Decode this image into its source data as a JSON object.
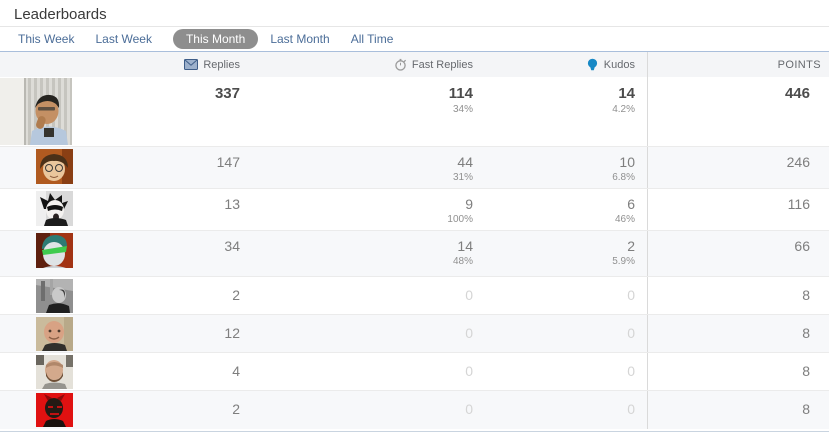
{
  "page": {
    "title": "Leaderboards"
  },
  "tabs": [
    {
      "label": "This Week",
      "active": false
    },
    {
      "label": "Last Week",
      "active": false
    },
    {
      "label": "This Month",
      "active": true
    },
    {
      "label": "Last Month",
      "active": false
    },
    {
      "label": "All Time",
      "active": false
    }
  ],
  "columns": {
    "replies": {
      "label": "Replies",
      "icon": "envelope-icon"
    },
    "fast_replies": {
      "label": "Fast Replies",
      "icon": "stopwatch-icon"
    },
    "kudos": {
      "label": "Kudos",
      "icon": "kudos-badge-icon"
    },
    "points": {
      "label": "POINTS"
    }
  },
  "colors": {
    "kudos_icon_blue": "#1788c5",
    "tab_text_blue": "#4b6d98",
    "active_tab_bg": "#8e8e8e",
    "tabs_underline": "#a9bedb",
    "header_band_bg": "#f4f5f7",
    "zero_value_text": "#d5d5d5"
  },
  "table": {
    "rows": [
      {
        "rank": 1,
        "replies": "337",
        "fast_replies": "114",
        "fast_replies_pct": "34%",
        "kudos": "14",
        "kudos_pct": "4.2%",
        "points": "446"
      },
      {
        "rank": 2,
        "replies": "147",
        "fast_replies": "44",
        "fast_replies_pct": "31%",
        "kudos": "10",
        "kudos_pct": "6.8%",
        "points": "246"
      },
      {
        "rank": 3,
        "replies": "13",
        "fast_replies": "9",
        "fast_replies_pct": "100%",
        "kudos": "6",
        "kudos_pct": "46%",
        "points": "116"
      },
      {
        "rank": 4,
        "replies": "34",
        "fast_replies": "14",
        "fast_replies_pct": "48%",
        "kudos": "2",
        "kudos_pct": "5.9%",
        "points": "66"
      },
      {
        "rank": 5,
        "replies": "2",
        "fast_replies": "0",
        "kudos": "0",
        "points": "8"
      },
      {
        "rank": 6,
        "replies": "12",
        "fast_replies": "0",
        "kudos": "0",
        "points": "8"
      },
      {
        "rank": 7,
        "replies": "4",
        "fast_replies": "0",
        "kudos": "0",
        "points": "8"
      },
      {
        "rank": 8,
        "replies": "2",
        "fast_replies": "0",
        "kudos": "0",
        "points": "8"
      }
    ]
  }
}
